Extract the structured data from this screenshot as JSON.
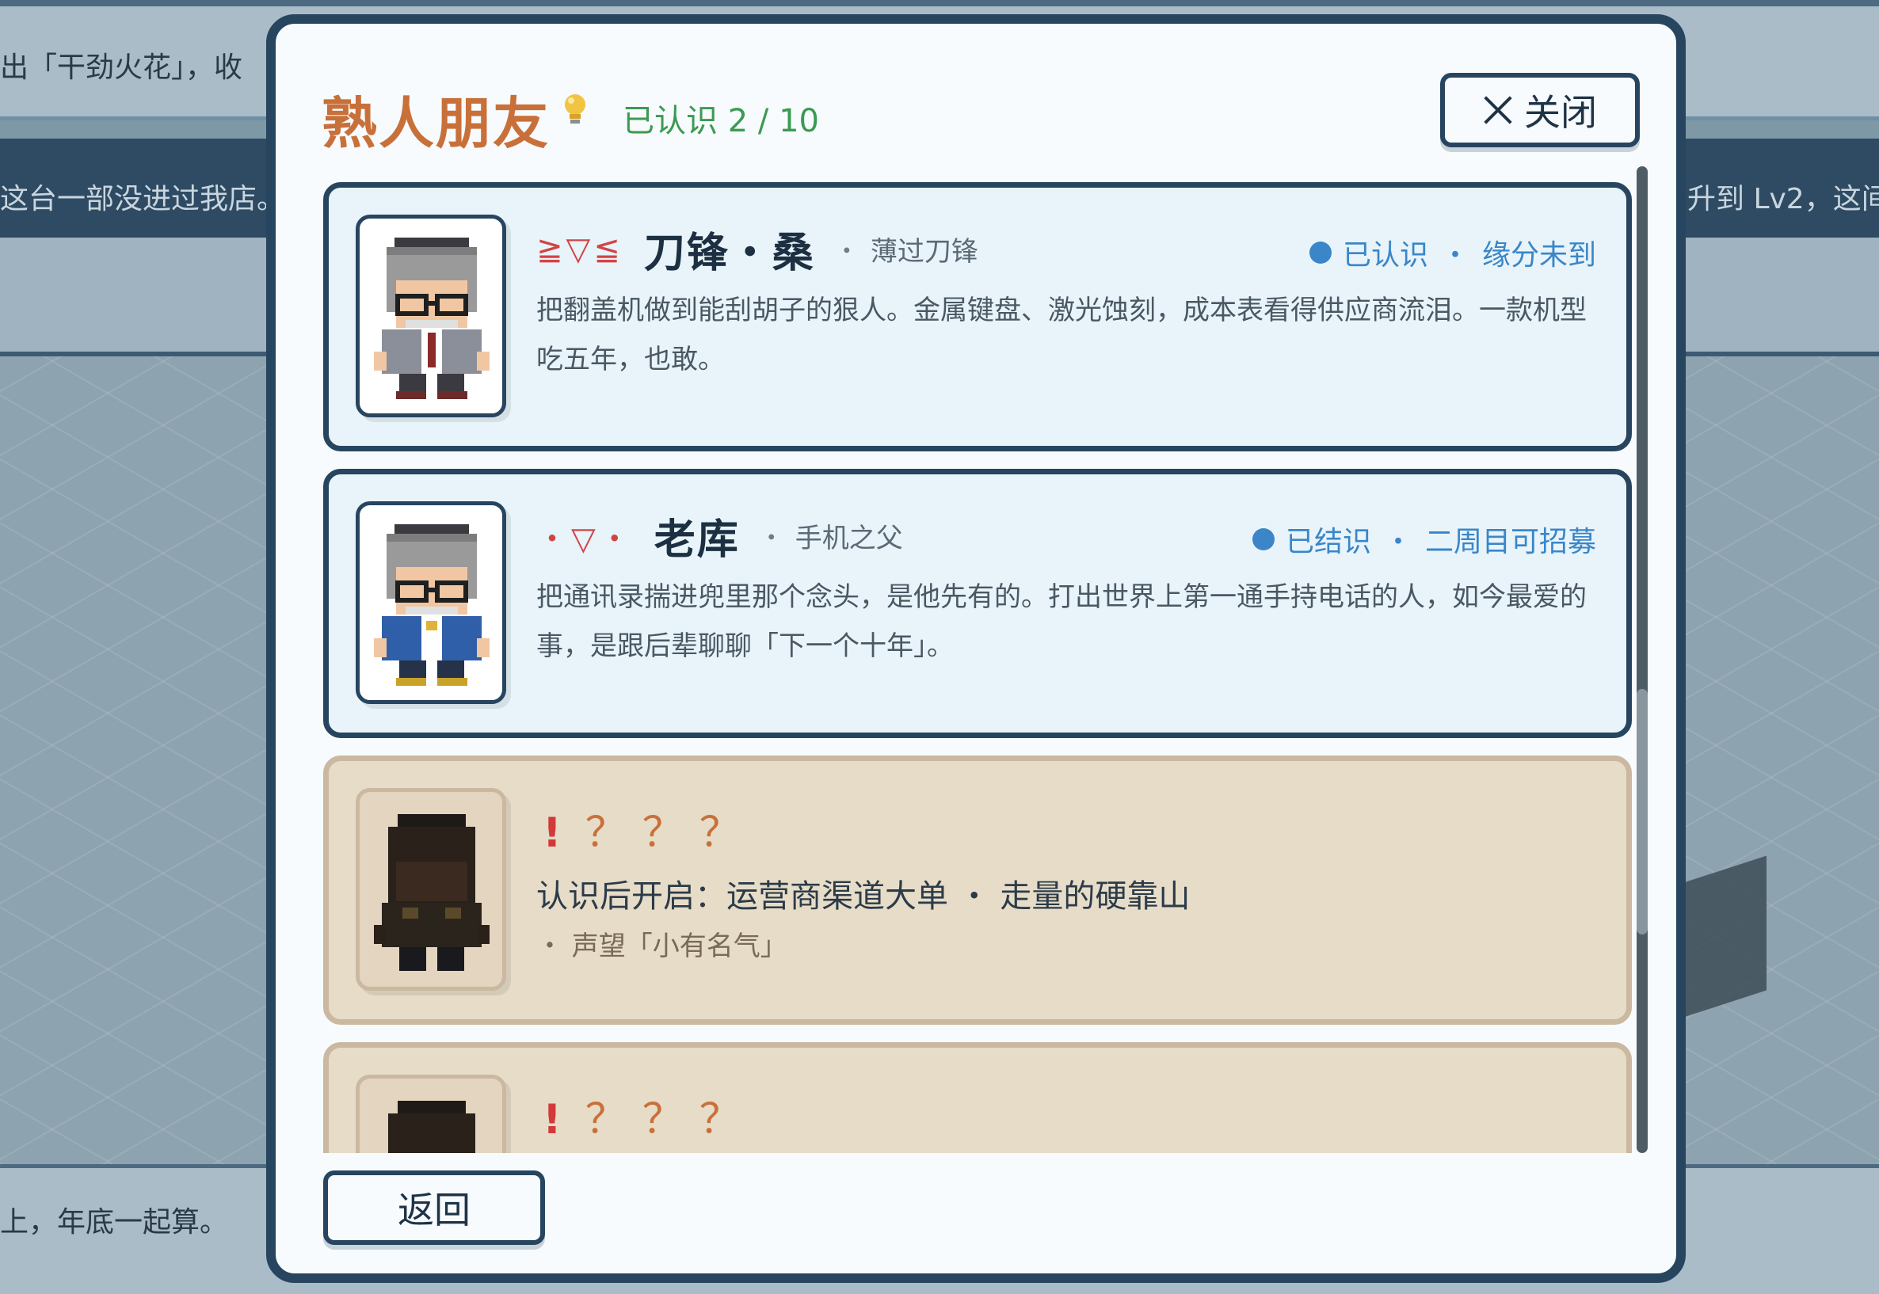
{
  "background": {
    "text_top": "出「干劲火花」，收",
    "text_banner_left": "这台一部没进过我店。",
    "text_banner_right": "升到 Lv2，这间",
    "text_bottom": "上，年底一起算。"
  },
  "modal": {
    "title": "熟人朋友",
    "bulb_icon": "lightbulb-icon",
    "known_count": "已认识 2 / 10",
    "close_label": "关闭",
    "back_label": "返回"
  },
  "friends": [
    {
      "face": "≧▽≦",
      "name": "刀锋・桑",
      "tagline": "薄过刀锋",
      "status_primary": "已认识",
      "status_secondary": "缘分未到",
      "description": "把翻盖机做到能刮胡子的狠人。金属键盘、激光蚀刻，成本表看得供应商流泪。一款机型吃五年，也敢。",
      "sep": "・"
    },
    {
      "face": "・▽・",
      "name": "老库",
      "tagline": "手机之父",
      "status_primary": "已结识",
      "status_secondary": "二周目可招募",
      "description": "把通讯录揣进兜里那个念头，是他先有的。打出世界上第一通手持电话的人，如今最爱的事，是跟后辈聊聊「下一个十年」。",
      "sep": "・"
    }
  ],
  "locked": [
    {
      "excl": "!",
      "mystery": "？？？",
      "unlock": "认识后开启：运营商渠道大单 ・ 走量的硬靠山",
      "requirement": "・ 声望「小有名气」"
    },
    {
      "excl": "!",
      "mystery": "？？？"
    }
  ],
  "colors": {
    "accent_orange": "#c9703a",
    "known_green": "#3c9a52",
    "status_blue": "#3a86c8",
    "border_navy": "#27455f",
    "locked_bg": "#e6dcc8"
  }
}
